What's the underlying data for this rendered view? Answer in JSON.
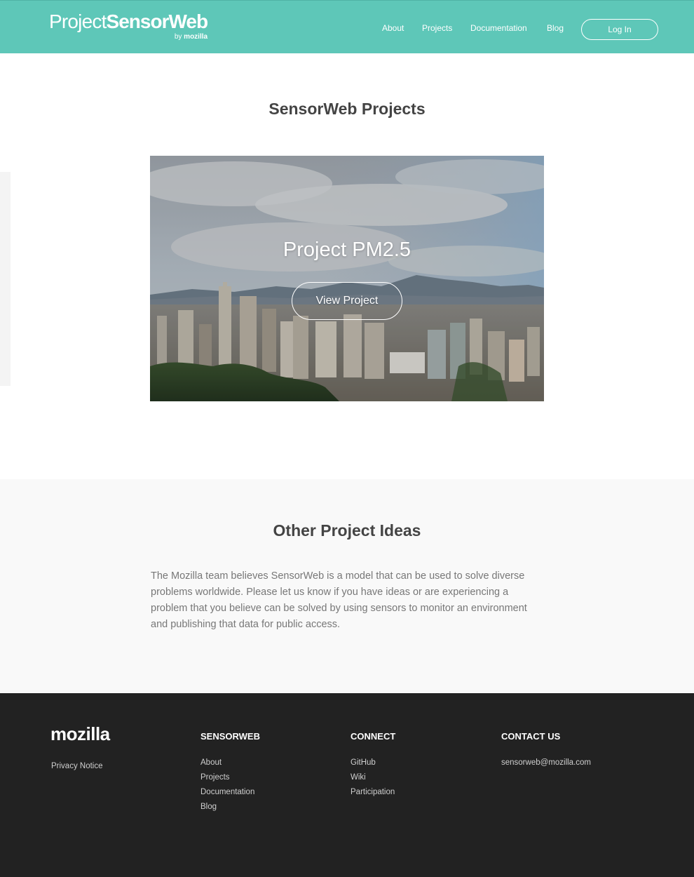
{
  "header": {
    "logo_word1": "Project",
    "logo_word2": "SensorWeb",
    "logo_by": "by",
    "logo_by_brand": "mozilla",
    "nav": [
      "About",
      "Projects",
      "Documentation",
      "Blog"
    ],
    "login_label": "Log In"
  },
  "projects": {
    "title": "SensorWeb Projects",
    "card_title": "Project PM2.5",
    "card_button": "View Project"
  },
  "ideas": {
    "title": "Other Project Ideas",
    "body": "The Mozilla team believes SensorWeb is a model that can be used to solve diverse problems worldwide. Please let us know if you have ideas or are experiencing a problem that you believe can be solved by using sensors to monitor an environment and publishing that data for public access."
  },
  "footer": {
    "brand": "mozilla",
    "brand_links": [
      "Privacy Notice"
    ],
    "columns": [
      {
        "heading": "SENSORWEB",
        "links": [
          "About",
          "Projects",
          "Documentation",
          "Blog"
        ]
      },
      {
        "heading": "CONNECT",
        "links": [
          "GitHub",
          "Wiki",
          "Participation"
        ]
      },
      {
        "heading": "CONTACT US",
        "links": [
          "sensorweb@mozilla.com"
        ]
      }
    ]
  },
  "colors": {
    "header_bg": "#5ec7b8",
    "footer_bg": "#222222",
    "ideas_bg": "#f9f9f9",
    "heading_text": "#444444"
  }
}
